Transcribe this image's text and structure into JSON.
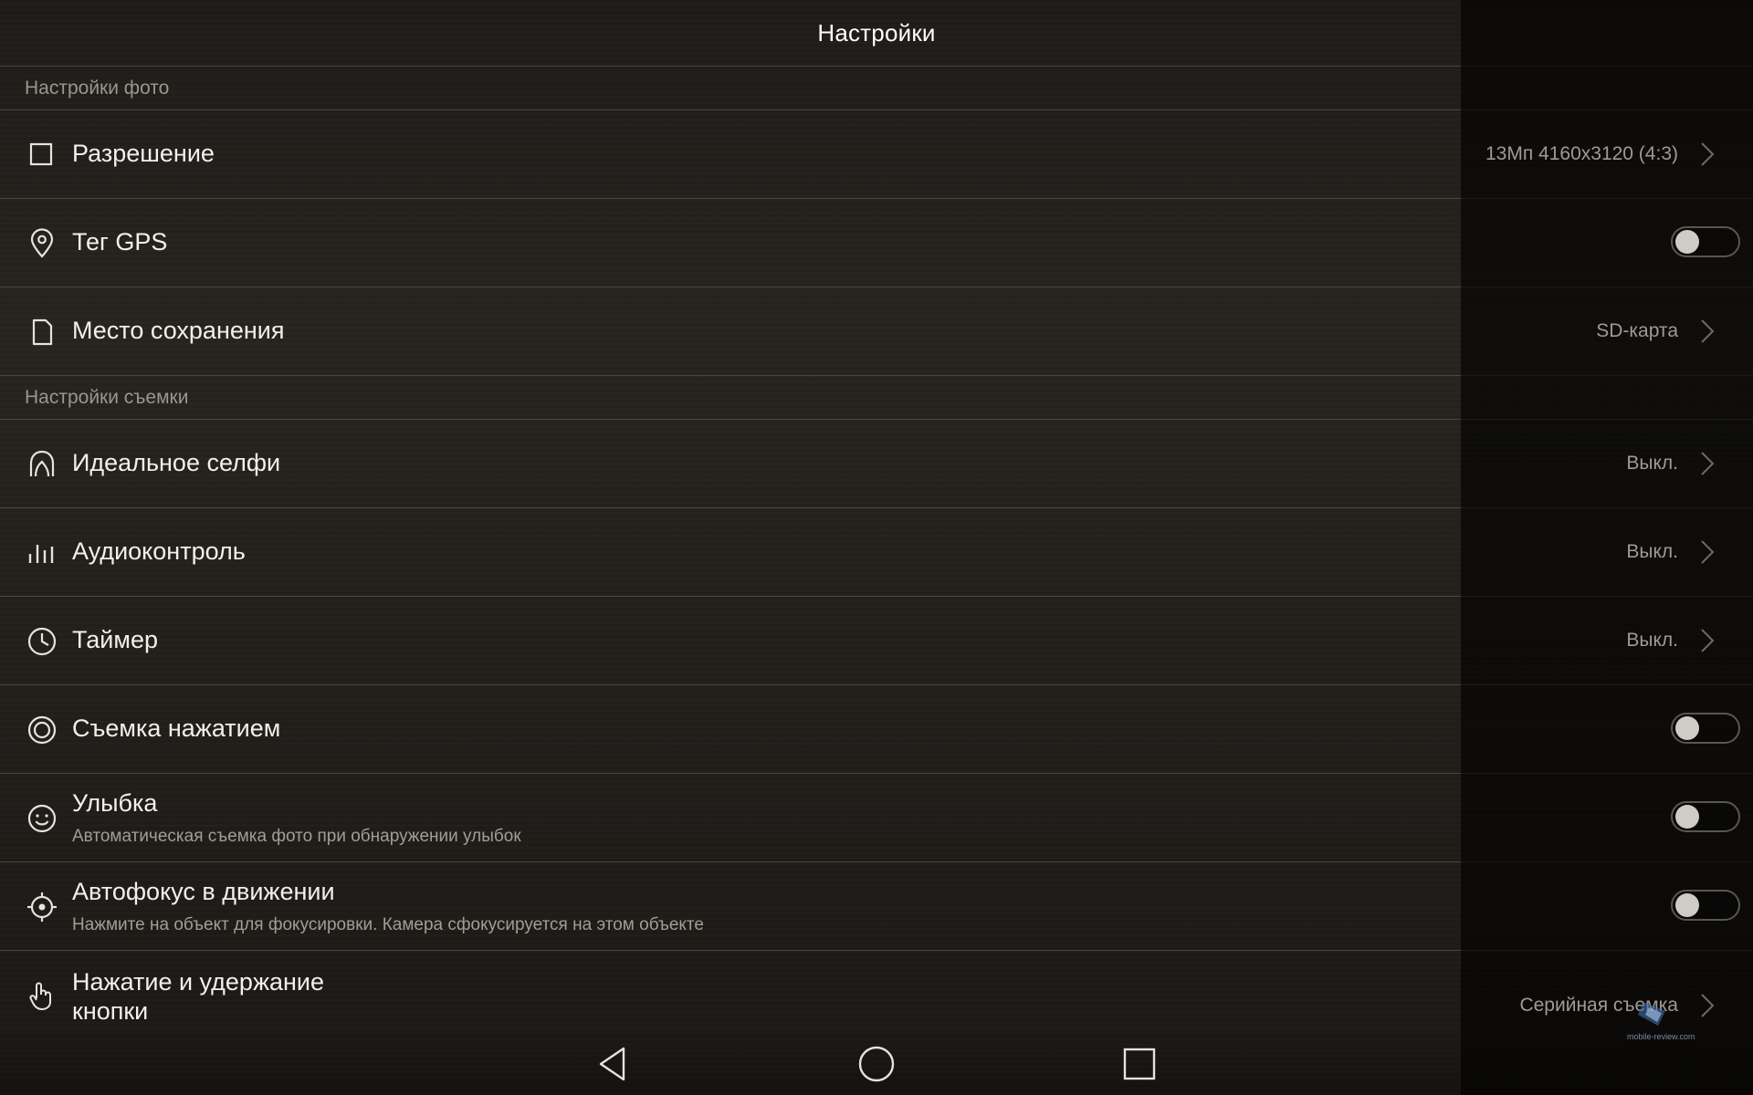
{
  "title": "Настройки",
  "sections": {
    "photo": "Настройки фото",
    "shooting": "Настройки съемки"
  },
  "rows": {
    "resolution": {
      "label": "Разрешение",
      "value": "13Мп 4160x3120 (4:3)",
      "icon": "resolution-square-icon"
    },
    "gps": {
      "label": "Тег GPS",
      "toggle": "off",
      "icon": "location-pin-icon"
    },
    "storage": {
      "label": "Место сохранения",
      "value": "SD-карта",
      "icon": "sd-card-icon"
    },
    "selfie": {
      "label": "Идеальное селфи",
      "value": "Выкл.",
      "icon": "face-outline-icon"
    },
    "audio": {
      "label": "Аудиоконтроль",
      "value": "Выкл.",
      "icon": "audio-bars-icon"
    },
    "timer": {
      "label": "Таймер",
      "value": "Выкл.",
      "icon": "clock-icon"
    },
    "touch": {
      "label": "Съемка нажатием",
      "toggle": "off",
      "icon": "touch-shutter-icon"
    },
    "smile": {
      "label": "Улыбка",
      "sub": "Автоматическая съемка фото при обнаружении улыбок",
      "toggle": "off",
      "icon": "smile-icon"
    },
    "autofocus": {
      "label": "Автофокус в движении",
      "sub": "Нажмите на объект для фокусировки. Камера сфокусируется на этом объекте",
      "toggle": "off",
      "icon": "focus-target-icon"
    },
    "hold": {
      "label": "Нажатие и удержание кнопки",
      "value": "Серийная съемка",
      "icon": "hand-press-icon"
    }
  },
  "watermark": "mobile-review.com",
  "colors": {
    "background": "#221f1b",
    "divider": "#4a4640",
    "text_primary": "#f2f0ec",
    "text_secondary": "#9f9a93"
  }
}
